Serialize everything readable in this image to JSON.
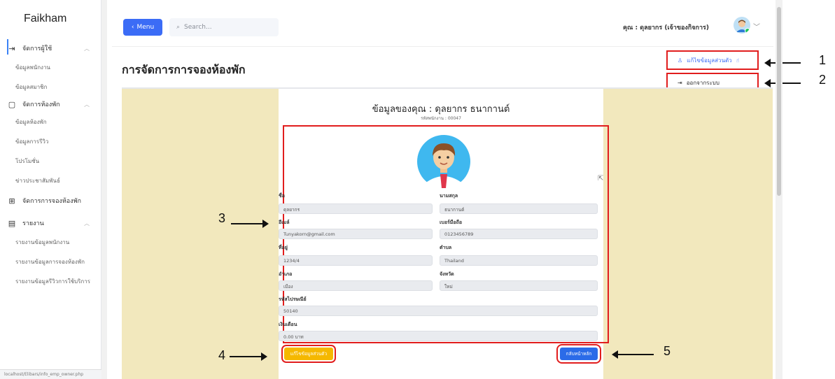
{
  "brand": "Faikham",
  "sidebar": {
    "groups": [
      {
        "label": "จัดการผู้ใช้",
        "icon": "user-login-icon",
        "items": [
          "ข้อมูลพนักงาน",
          "ข้อมูลสมาชิก"
        ]
      },
      {
        "label": "จัดการห้องพัก",
        "icon": "document-icon",
        "items": [
          "ข้อมูลห้องพัก",
          "ข้อมูลการรีวิว",
          "โปรโมชั่น",
          "ข่าวประชาสัมพันธ์"
        ]
      },
      {
        "label": "จัดการการจองห้องพัก",
        "icon": "grid-table-icon",
        "items": []
      },
      {
        "label": "รายงาน",
        "icon": "report-icon",
        "items": [
          "รายงานข้อมูลพนักงาน",
          "รายงานข้อมูลการจองห้องพัก",
          "รายงานข้อมูลรีวิวการใช้บริการ"
        ]
      }
    ],
    "footer": "localhost/Elibars/info_emp_owner.php"
  },
  "header": {
    "menu_label": "Menu",
    "search_placeholder": "Search...",
    "user_text": "คุณ : ดุลยากร (เจ้าของกิจการ)"
  },
  "dropdown": {
    "edit_label": "แก้ไขข้อมูลส่วนตัว",
    "logout_label": "ออกจากระบบ"
  },
  "page_title": "การจัดการการจองห้องพัก",
  "profile": {
    "title": "ข้อมูลของคุณ : ดุลยากร ธนากานต์",
    "subtitle": "รหัสพนักงาน : 00047",
    "fields": {
      "first_name_label": "ชื่อ",
      "first_name": "ดุลยากร",
      "last_name_label": "นามสกุล",
      "last_name": "ธนากานต์",
      "email_label": "อีเมล์",
      "email": "Tunyakorn@gmail.com",
      "phone_label": "เบอร์มือถือ",
      "phone": "0123456789",
      "address_label": "ที่อยู่",
      "address": "1234/4",
      "subdistrict_label": "ตำบล",
      "subdistrict": "Thailand",
      "district_label": "อำเภอ",
      "district": "เมือง",
      "province_label": "จังหวัด",
      "province": "ใหม่",
      "postcode_label": "รหัสไปรษณีย์",
      "postcode": "50140",
      "salary_label": "เงินเดือน",
      "salary": "0.00 บาท"
    },
    "edit_button": "แก้ไขข้อมูลส่วนตัว",
    "home_button": "กลับหน้าหลัก"
  },
  "annotations": {
    "n1": "1",
    "n2": "2",
    "n3": "3",
    "n4": "4",
    "n5": "5"
  },
  "colors": {
    "accent": "#3b6cf6",
    "highlight": "#e11d1d",
    "content_bg": "#f2e8bd",
    "edit_btn": "#f5b800"
  }
}
